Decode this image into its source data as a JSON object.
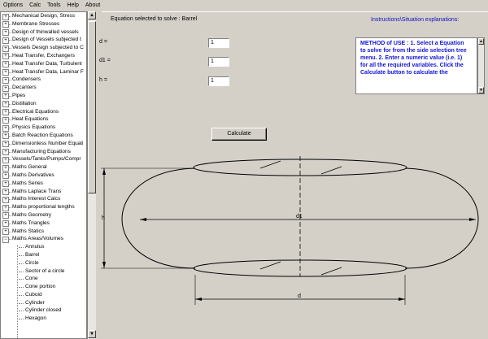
{
  "menubar": {
    "items": [
      "Options",
      "Calc",
      "Tools",
      "Help",
      "About"
    ]
  },
  "tree": {
    "categories": [
      "Mechanical Design, Stress",
      "Membrane Stresses",
      "Design of thinwalled vessels",
      "Design of Vessels subjected t",
      "Vessels Design subjected to C",
      "Heat Transfer, Exchangers",
      "Heat Transfer Data, Turbulent",
      "Heat Transfer Data, Laminar F",
      "Condensers",
      "Decanters",
      "Pipes",
      "Distillation",
      "Electrical Equations",
      "Heat Equations",
      "Physics Equations",
      "Batch Reaction Equations",
      "Dimensionless Number Equati",
      "Manufacturing Equations",
      "Vessels/Tanks/Pumps/Compr",
      "Maths General",
      "Maths Derivatives",
      "Maths Series",
      "Maths Laplace Trans",
      "Maths Interest Calcs",
      "Maths proportional lengths",
      "Maths Geometry",
      "Maths Triangles",
      "Maths Statics",
      "Maths Areas/Volumes"
    ],
    "children": [
      "Annulus",
      "Barrel",
      "Circle",
      "Sector of a circle",
      "Cone",
      "Cone portion",
      "Cuboid",
      "Cylinder",
      "Cylinder closed",
      "Hexagon"
    ]
  },
  "equation": {
    "selected_label": "Equation selected to solve : Barrel"
  },
  "inputs": [
    {
      "label": "d =",
      "value": "1"
    },
    {
      "label": "d1 =",
      "value": "1"
    },
    {
      "label": "h =",
      "value": "1"
    }
  ],
  "calculate_label": "Calculate",
  "instructions": {
    "title": "Instructions\\Situation explanations:",
    "text": "METHOD of USE : 1. Select a Equation to solve for from the side selection tree menu. 2. Enter a numeric value (i.e. 1) for all the required variables. Click the Calculate button to calculate the"
  },
  "diagram": {
    "label_d1": "d1",
    "label_h": "h",
    "label_d": "d"
  },
  "colors": {
    "window_bg": "#d4d0c8",
    "instruction_text": "#1414d8"
  }
}
